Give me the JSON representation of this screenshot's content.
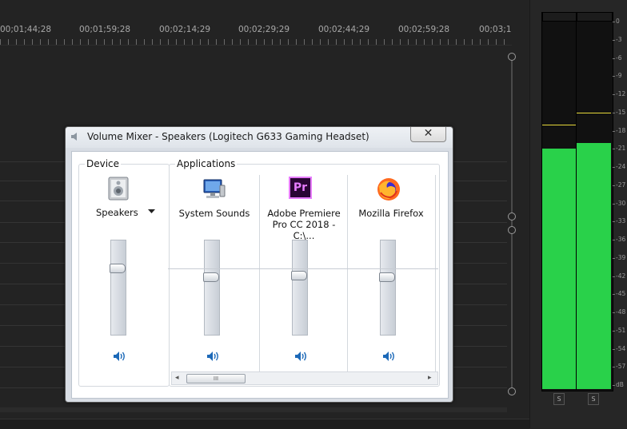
{
  "timeline": {
    "timecodes": [
      "00;01;44;28",
      "00;01;59;28",
      "00;02;14;29",
      "00;02;29;29",
      "00;02;44;29",
      "00;02;59;28",
      "00;03;1"
    ]
  },
  "meter": {
    "scale": [
      "0",
      "-3",
      "-6",
      "-9",
      "-12",
      "-15",
      "-18",
      "-21",
      "-24",
      "-27",
      "-30",
      "-33",
      "-36",
      "-39",
      "-42",
      "-45",
      "-48",
      "-51",
      "-54",
      "-57",
      "dB"
    ],
    "solo_left": "S",
    "solo_right": "S",
    "left_level_db": -21,
    "right_level_db": -20,
    "left_peak_db": -17,
    "right_peak_db": -15,
    "bar_color": "#29d14a",
    "peak_color": "#e6d83a"
  },
  "mixer": {
    "title": "Volume Mixer - Speakers (Logitech G633 Gaming Headset)",
    "close_label": "✕",
    "device_group": "Device",
    "apps_group": "Applications",
    "device": {
      "name": "Speakers",
      "icon": "speaker-device-icon",
      "level": 0.72
    },
    "apps": [
      {
        "name": "System Sounds",
        "icon": "system-sounds-icon",
        "level": 0.62
      },
      {
        "name": "Adobe Premiere Pro CC 2018 - C:\\...",
        "name_line1": "Adobe Premiere",
        "name_line2": "Pro CC 2018 - C:\\...",
        "icon": "premiere-pro-icon",
        "icon_text": "Pr",
        "level": 0.64
      },
      {
        "name": "Mozilla Firefox",
        "icon": "firefox-icon",
        "level": 0.62
      }
    ],
    "scroll_grip": "III",
    "scroll_left": "◂",
    "scroll_right": "▸"
  }
}
